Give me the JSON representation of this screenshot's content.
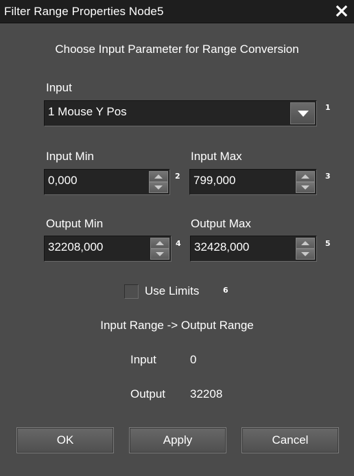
{
  "window": {
    "title": "Filter Range Properties Node5"
  },
  "heading": "Choose Input Parameter for Range Conversion",
  "input": {
    "label": "Input",
    "selected": "1 Mouse Y Pos",
    "badge": "1"
  },
  "input_min": {
    "label": "Input Min",
    "value": "0,000",
    "badge": "2"
  },
  "input_max": {
    "label": "Input Max",
    "value": "799,000",
    "badge": "3"
  },
  "output_min": {
    "label": "Output Min",
    "value": "32208,000",
    "badge": "4"
  },
  "output_max": {
    "label": "Output Max",
    "value": "32428,000",
    "badge": "5"
  },
  "use_limits": {
    "label": "Use Limits",
    "checked": false,
    "badge": "6"
  },
  "range_caption": "Input Range -> Output Range",
  "result": {
    "input_label": "Input",
    "input_value": "0",
    "output_label": "Output",
    "output_value": "32208"
  },
  "buttons": {
    "ok": "OK",
    "apply": "Apply",
    "cancel": "Cancel"
  },
  "colors": {
    "background": "#4b4b4b",
    "titlebar": "#1e1e1e",
    "field": "#242424",
    "text": "#ffffff"
  },
  "icons": {
    "close": "close-icon",
    "dropdown": "chevron-down-icon",
    "spin_up": "arrow-up-icon",
    "spin_down": "arrow-down-icon"
  }
}
